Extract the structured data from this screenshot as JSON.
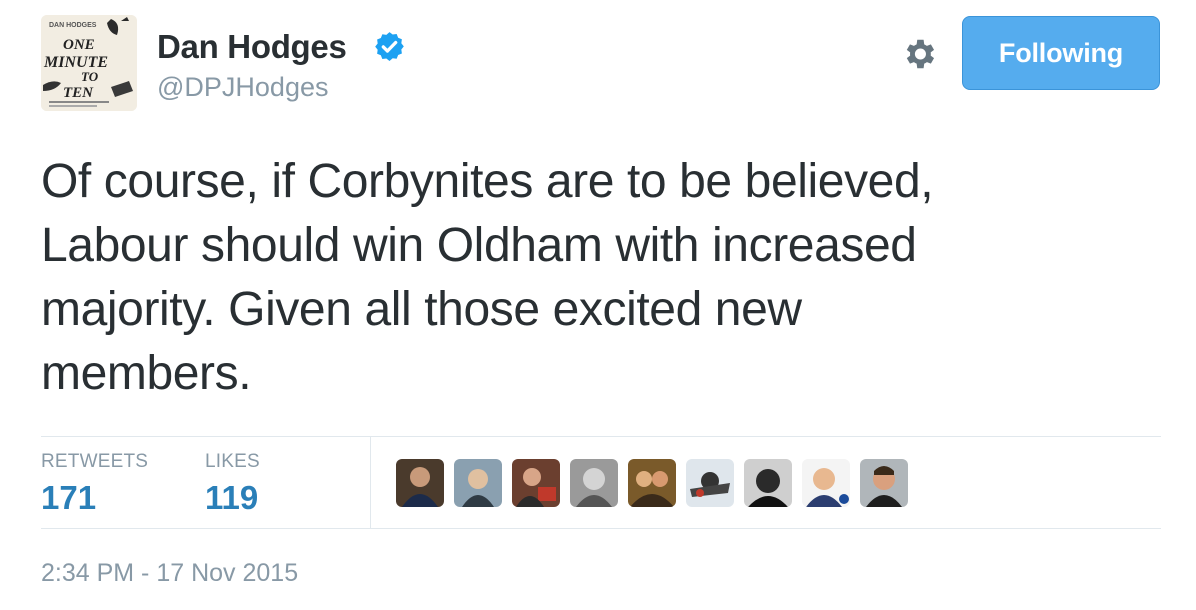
{
  "author": {
    "name": "Dan Hodges",
    "handle": "@DPJHodges",
    "verified": true,
    "avatar": {
      "top_line": "DAN HODGES",
      "line1": "ONE",
      "line2": "MINUTE",
      "line3": "TO",
      "line4": "TEN"
    }
  },
  "actions": {
    "settings_icon": "gear-icon",
    "follow_label": "Following"
  },
  "tweet": {
    "text": "Of course, if Corbynites are to be believed,\nLabour should win Oldham with  increased\nmajority. Given all those excited new\nmembers."
  },
  "stats": {
    "retweets_label": "RETWEETS",
    "retweets_count": "171",
    "likes_label": "LIKES",
    "likes_count": "119"
  },
  "likers_count_shown": 9,
  "timestamp": "2:34 PM - 17 Nov 2015",
  "colors": {
    "accent": "#55acee",
    "count_blue": "#2a7fb8",
    "muted": "#8899a6",
    "text": "#292f33",
    "divider": "#e1e8ed"
  }
}
